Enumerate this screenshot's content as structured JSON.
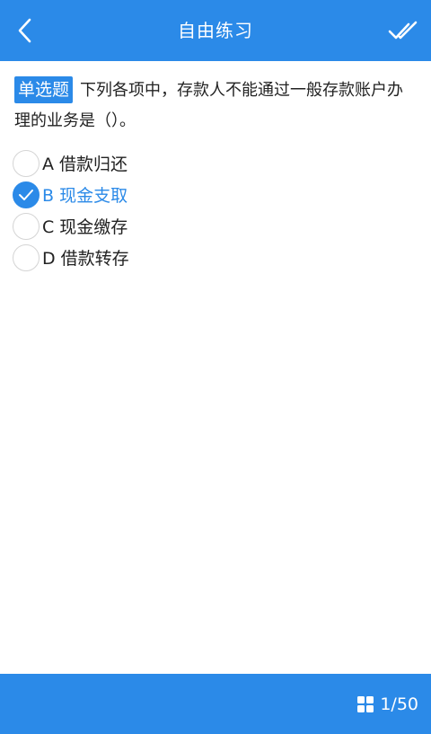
{
  "header": {
    "title": "自由练习",
    "back_icon": "chevron-left-icon",
    "submit_icon": "double-check-icon"
  },
  "question": {
    "type_label": "单选题",
    "text": "下列各项中，存款人不能通过一般存款账户办理的业务是（）。"
  },
  "options": [
    {
      "text": "A 借款归还",
      "selected": false
    },
    {
      "text": "B 现金支取",
      "selected": true
    },
    {
      "text": "C 现金缴存",
      "selected": false
    },
    {
      "text": "D 借款转存",
      "selected": false
    }
  ],
  "footer": {
    "grid_icon": "grid-icon",
    "progress": "1/50"
  },
  "colors": {
    "accent": "#2b8ae8",
    "text": "#222222",
    "radio_border": "#d4d4d4"
  }
}
